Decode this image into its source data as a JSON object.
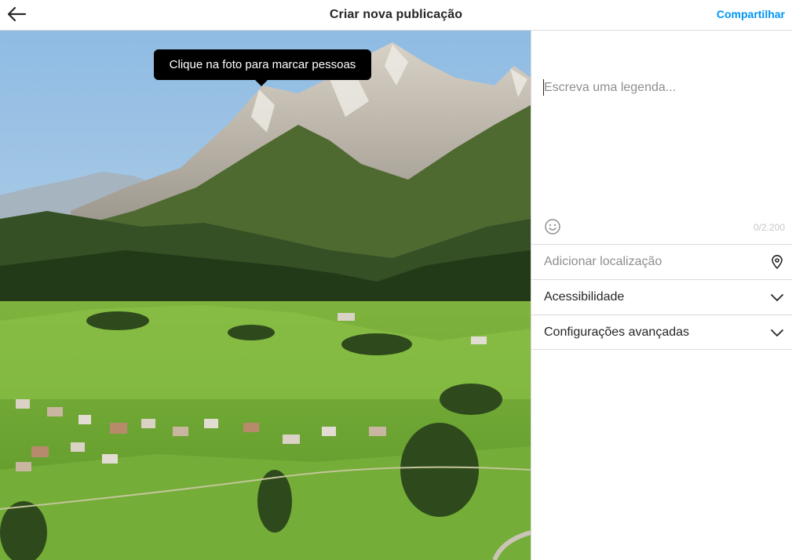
{
  "header": {
    "title": "Criar nova publicação",
    "back_icon": "arrow-left-icon",
    "share_label": "Compartilhar",
    "share_color": "#0095f6"
  },
  "photo": {
    "tooltip": "Clique na foto para marcar pessoas"
  },
  "caption": {
    "placeholder": "Escreva uma legenda...",
    "value": "",
    "emoji_icon": "smiley-icon",
    "counter": "0/2.200"
  },
  "options": {
    "location_label": "Adicionar localização",
    "location_icon": "location-pin-icon",
    "accessibility_label": "Acessibilidade",
    "advanced_label": "Configurações avançadas",
    "chevron_icon": "chevron-down-icon"
  }
}
